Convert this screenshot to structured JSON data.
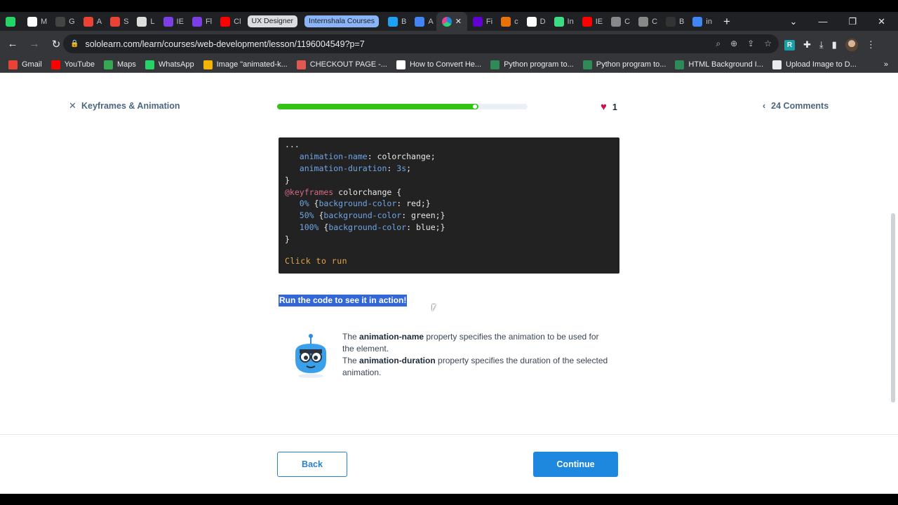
{
  "tabs": [
    {
      "label": "",
      "color": "#25d366"
    },
    {
      "label": "M",
      "color": "#ffffff"
    },
    {
      "label": "G",
      "color": "#444444"
    },
    {
      "label": "A",
      "color": "#ea4335"
    },
    {
      "label": "S",
      "color": "#ea4335"
    },
    {
      "label": "L",
      "color": "#dddddd"
    },
    {
      "label": "IE",
      "color": "#7b3fe4"
    },
    {
      "label": "Fl",
      "color": "#7b3fe4"
    },
    {
      "label": "Cl",
      "color": "#ff0000"
    }
  ],
  "tab_groups": [
    "UX Designer",
    "Internshala Courses"
  ],
  "tabs_after": [
    {
      "label": "B",
      "color": "#1da1f2"
    },
    {
      "label": "A",
      "color": "#4285f4"
    }
  ],
  "tabs_end": [
    {
      "label": "Fi",
      "color": "#6001d2"
    },
    {
      "label": "c",
      "color": "#e8710a"
    },
    {
      "label": "D",
      "color": "#ffffff"
    },
    {
      "label": "In",
      "color": "#3ddc84"
    },
    {
      "label": "IE",
      "color": "#ff0000"
    },
    {
      "label": "C",
      "color": "#888888"
    },
    {
      "label": "C",
      "color": "#888888"
    },
    {
      "label": "B",
      "color": "#333333"
    },
    {
      "label": "in",
      "color": "#4285f4"
    }
  ],
  "window_controls": {
    "min": "—",
    "max": "❐",
    "close": "✕"
  },
  "url": "sololearn.com/learn/courses/web-development/lesson/1196004549?p=7",
  "bookmarks": [
    {
      "label": "Gmail",
      "color": "#ea4335"
    },
    {
      "label": "YouTube",
      "color": "#ff0000"
    },
    {
      "label": "Maps",
      "color": "#34a853"
    },
    {
      "label": "WhatsApp",
      "color": "#25d366"
    },
    {
      "label": "Image \"animated-k...",
      "color": "#f4b400"
    },
    {
      "label": "CHECKOUT PAGE -...",
      "color": "#e0584f"
    },
    {
      "label": "How to Convert He...",
      "color": "#ffffff"
    },
    {
      "label": "Python program to...",
      "color": "#2e8b57"
    },
    {
      "label": "Python program to...",
      "color": "#2e8b57"
    },
    {
      "label": "HTML Background I...",
      "color": "#2e8b57"
    },
    {
      "label": "Upload Image to D...",
      "color": "#e8eaed"
    }
  ],
  "lesson": {
    "title": "Keyframes & Animation",
    "progress": 0.805,
    "hearts": "1",
    "comments": "24 Comments"
  },
  "code": {
    "lines": [
      [
        {
          "t": "...",
          "c": ""
        }
      ],
      [
        {
          "t": "   animation-name",
          "c": "prop"
        },
        {
          "t": ": colorchange;",
          "c": ""
        }
      ],
      [
        {
          "t": "   animation-duration",
          "c": "prop"
        },
        {
          "t": ": ",
          "c": ""
        },
        {
          "t": "3s",
          "c": "num"
        },
        {
          "t": ";",
          "c": ""
        }
      ],
      [
        {
          "t": "}",
          "c": ""
        }
      ],
      [
        {
          "t": "@keyframes",
          "c": "at"
        },
        {
          "t": " colorchange {",
          "c": ""
        }
      ],
      [
        {
          "t": "   0%",
          "c": "num"
        },
        {
          "t": " {",
          "c": ""
        },
        {
          "t": "background-color",
          "c": "prop"
        },
        {
          "t": ": red;}",
          "c": ""
        }
      ],
      [
        {
          "t": "   50%",
          "c": "num"
        },
        {
          "t": " {",
          "c": ""
        },
        {
          "t": "background-color",
          "c": "prop"
        },
        {
          "t": ": green;}",
          "c": ""
        }
      ],
      [
        {
          "t": "   100%",
          "c": "num"
        },
        {
          "t": " {",
          "c": ""
        },
        {
          "t": "background-color",
          "c": "prop"
        },
        {
          "t": ": blue;}",
          "c": ""
        }
      ],
      [
        {
          "t": "}",
          "c": ""
        }
      ]
    ],
    "run_label": "Click to run"
  },
  "highlight": "Run the code to see it in action!",
  "info": {
    "p1_pre": "The ",
    "p1_bold": "animation-name",
    "p1_post": " property specifies the animation to be used for the element.",
    "p2_pre": "The ",
    "p2_bold": "animation-duration",
    "p2_post": " property specifies the duration of the selected animation."
  },
  "buttons": {
    "back": "Back",
    "continue": "Continue"
  }
}
